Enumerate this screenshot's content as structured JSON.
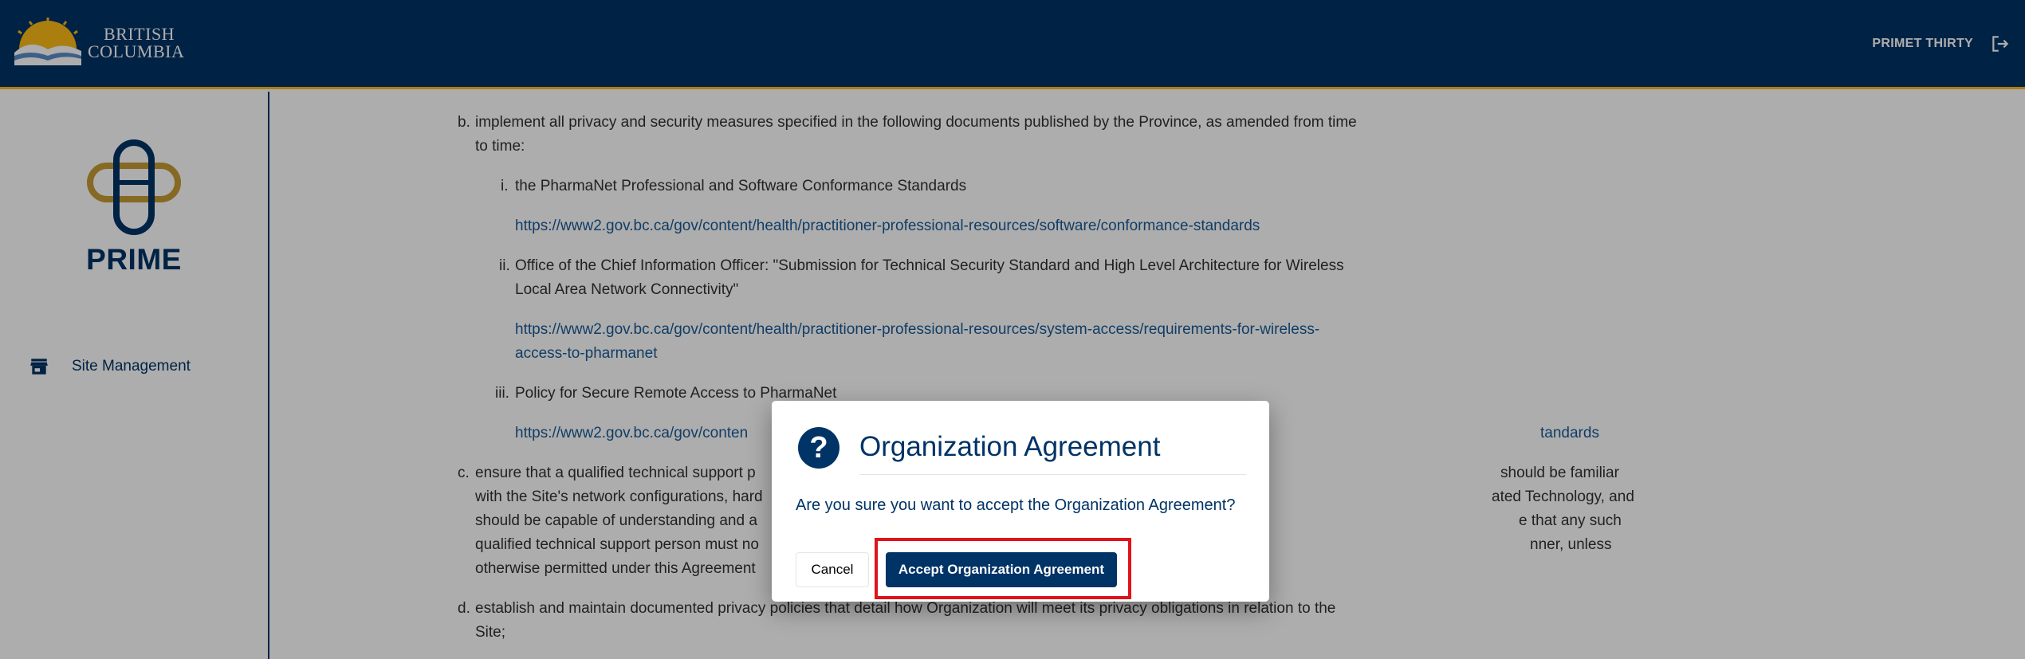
{
  "header": {
    "brand_line1": "BRITISH",
    "brand_line2": "COLUMBIA",
    "user_name": "PRIMET THIRTY",
    "logout_icon": "logout-icon"
  },
  "sidebar": {
    "app_name": "PRIME",
    "items": [
      {
        "label": "Site Management",
        "icon": "store-icon"
      }
    ]
  },
  "agreement": {
    "b_marker": "b.",
    "b_text_1": "implement all privacy and security measures specified in the following documents published by the Province, as amended from time",
    "b_text_2": "to time:",
    "i_marker": "i.",
    "i_text": "the PharmaNet Professional and Software Conformance Standards",
    "i_link": "https://www2.gov.bc.ca/gov/content/health/practitioner-professional-resources/software/conformance-standards",
    "ii_marker": "ii.",
    "ii_text_1": "Office of the Chief Information Officer: \"Submission for Technical Security Standard and High Level Architecture for Wireless",
    "ii_text_2": "Local Area Network Connectivity\"",
    "ii_link_1": "https://www2.gov.bc.ca/gov/content/health/practitioner-professional-resources/system-access/requirements-for-wireless-",
    "ii_link_2": "access-to-pharmanet",
    "iii_marker": "iii.",
    "iii_text": "Policy for Secure Remote Access to PharmaNet",
    "iii_link_start": "https://www2.gov.bc.ca/gov/conten",
    "iii_link_end": "tandards",
    "c_marker": "c.",
    "c_line1_start": "ensure that a qualified technical support p",
    "c_line1_end": "should be familiar",
    "c_line2_start": "with the Site's network configurations, hard",
    "c_line2_end": "ated Technology, and",
    "c_line3_start": "should be capable of understanding and a",
    "c_line3_end": "e that any such",
    "c_line4_start": "qualified technical support person must no",
    "c_line4_end": "nner, unless",
    "c_line5_start": "otherwise permitted under this Agreement",
    "d_marker": "d.",
    "d_text_1": "establish and maintain documented privacy policies that detail how Organization will meet its privacy obligations in relation to the",
    "d_text_2": "Site;"
  },
  "dialog": {
    "icon": "question-icon",
    "title": "Organization Agreement",
    "message": "Are you sure you want to accept the Organization Agreement?",
    "cancel_label": "Cancel",
    "accept_label": "Accept Organization Agreement"
  },
  "colors": {
    "header_bg": "#003366",
    "header_accent": "#fcba19",
    "link": "#1a5a96",
    "highlight": "#e0121a"
  }
}
